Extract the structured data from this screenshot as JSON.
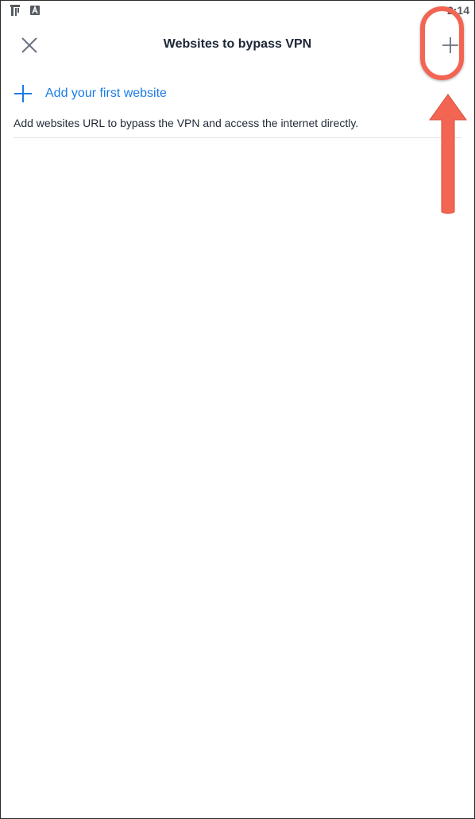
{
  "status_bar": {
    "time": "2:14",
    "icons": [
      "tools-notification-icon",
      "font-notification-icon"
    ]
  },
  "header": {
    "title": "Websites to bypass VPN",
    "close_icon": "close-icon",
    "add_icon": "plus-icon"
  },
  "content": {
    "add_first_label": "Add your first website",
    "description": "Add websites URL to bypass the VPN and access the internet directly."
  },
  "colors": {
    "accent": "#1a7be6",
    "annotation": "#f26552",
    "title": "#1b2636"
  }
}
